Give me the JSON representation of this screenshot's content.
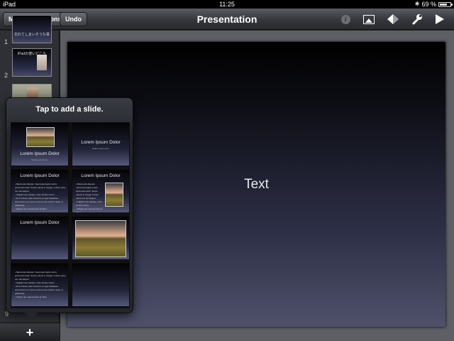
{
  "status": {
    "carrier": "iPad",
    "time": "11:25",
    "battery": "69 %",
    "battery_fraction": 0.69
  },
  "toolbar": {
    "presentations_label": "My Presentations",
    "undo_label": "Undo",
    "title": "Presentation",
    "icons": [
      "info-icon",
      "media-icon",
      "format-icon",
      "tools-icon",
      "play-icon"
    ]
  },
  "navigator": {
    "slides": [
      {
        "number": "1",
        "title": "忘れてしまいそうな事"
      },
      {
        "number": "2",
        "title": "iPadの使いどころ"
      },
      {
        "number": "",
        "title": ""
      }
    ],
    "last_number": "9",
    "add_label": "+"
  },
  "canvas": {
    "text": "Text"
  },
  "popover": {
    "title": "Tap to add a slide.",
    "layouts": [
      {
        "title": "Lorem Ipsum Dolor",
        "sub": "Nullam quis lorem"
      },
      {
        "title": "Lorem Ipsum Dolor",
        "sub": "Nullam quis lorem"
      },
      {
        "title": "Lorem Ipsum Dolor"
      },
      {
        "title": "Lorem Ipsum Dolor"
      },
      {
        "title": "Lorem Ipsum Dolor"
      },
      {
        "title": ""
      },
      {
        "title": ""
      },
      {
        "title": ""
      }
    ],
    "bullets": [
      "• Maecenas aliquam maecenas ligula nostra accumsan taciti. Sociis mauris in integer a dolor netus non dui aliquet.",
      "• Sagittis tota sodales, dolor iaculis rutrum.",
      "• Et ac fames vitae interdum et eget habitasse elementum est, ipsum purus pede porttitor class, ut adipiscing.",
      "• Aliquet nec viverra amet at dolor."
    ]
  }
}
